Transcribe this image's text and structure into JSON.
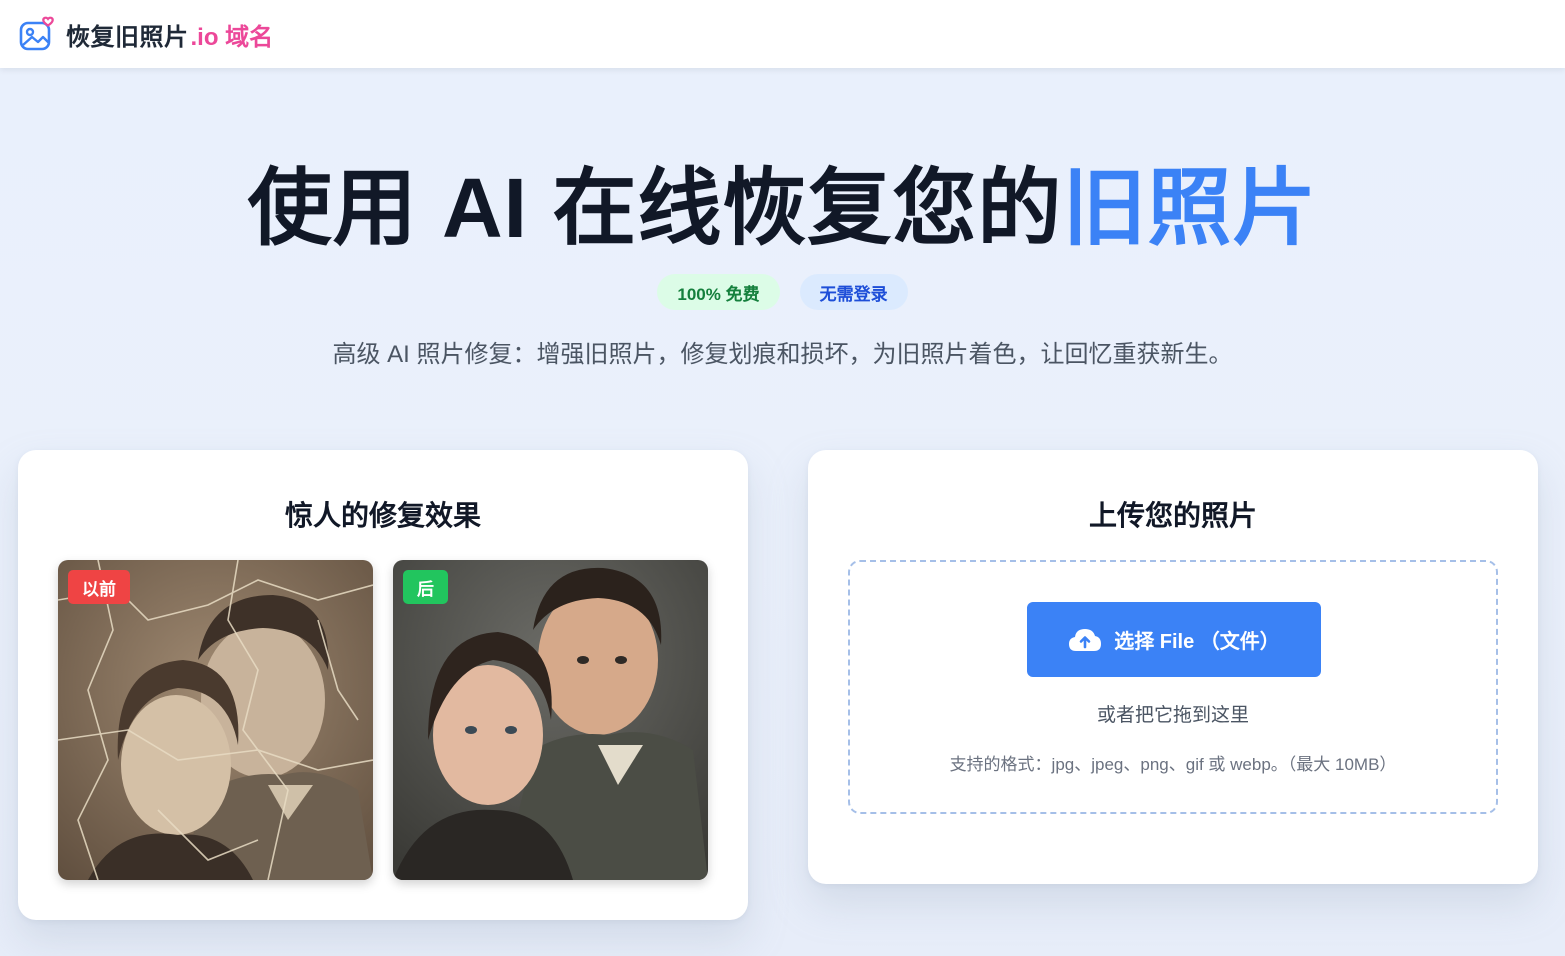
{
  "header": {
    "brand": "恢复旧照片",
    "brand_suffix": ".io 域名"
  },
  "hero": {
    "title_main": "使用 AI 在线恢复您的",
    "title_accent": "旧照片",
    "badges": [
      "100% 免费",
      "无需登录"
    ],
    "subtitle": "高级 AI 照片修复：增强旧照片，修复划痕和损坏，为旧照片着色，让回忆重获新生。"
  },
  "showcase": {
    "title": "惊人的修复效果",
    "before_label": "以前",
    "after_label": "后"
  },
  "upload": {
    "title": "上传您的照片",
    "button_label": "选择 File （文件）",
    "drop_hint": "或者把它拖到这里",
    "formats": "支持的格式：jpg、jpeg、png、gif 或 webp。（最大 10MB）"
  },
  "colors": {
    "accent": "#3b82f6",
    "brand_pink": "#ec4899",
    "before_tag": "#ef4444",
    "after_tag": "#22c55e"
  },
  "icons": [
    "photo-heart-logo-icon",
    "cloud-upload-icon"
  ]
}
